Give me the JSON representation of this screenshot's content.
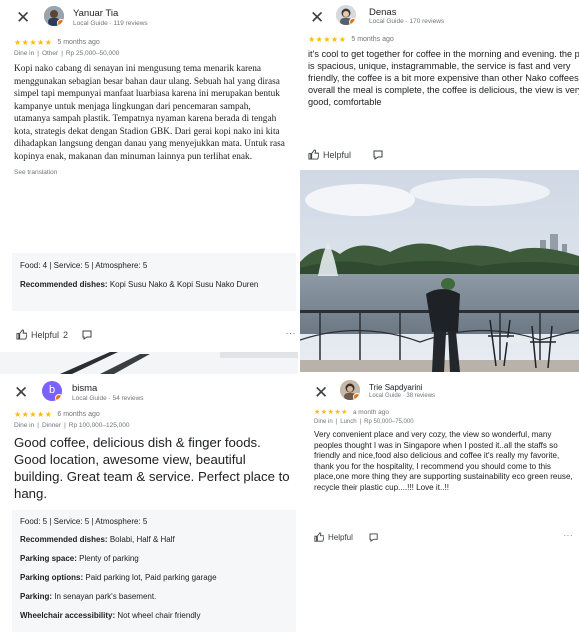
{
  "reviews": [
    {
      "reviewer_name": "Yanuar Tia",
      "reviewer_meta": "Local Guide · 119 reviews",
      "stars": "★★★★★",
      "time": "5 months ago",
      "meal_type": "Dine in",
      "meal_kind": "Other",
      "price": "Rp 25,000–50,000",
      "body": "Kopi nako cabang di senayan ini mengusung tema menarik karena menggunakan sebagian besar bahan daur ulang. Sebuah hal yang dirasa simpel tapi mempunyai manfaat luarbiasa karena ini merupakan bentuk kampanye untuk menjaga lingkungan dari pencemaran sampah, utamanya sampah plastik. Tempatnya nyaman karena berada di tengah kota, strategis dekat dengan Stadion GBK. Dari gerai kopi nako ini kita dihadapkan langsung dengan danau yang menyejukkan mata. Untuk rasa kopinya enak, makanan dan minuman lainnya pun terlihat enak.",
      "see_translation": "See translation",
      "ratings_line": "Food: 4 | Service: 5 | Atmosphere: 5",
      "recommended_label": "Recommended dishes:",
      "recommended_value": "Kopi Susu Nako & Kopi Susu Nako Duren",
      "helpful_label": "Helpful",
      "helpful_count": "2",
      "more": "···"
    },
    {
      "reviewer_name": "Denas",
      "reviewer_meta": "Local Guide · 170 reviews",
      "stars": "★★★★★",
      "time": "5 months ago",
      "body": "it's cool to get together for coffee in the morning and evening.  the place is spacious, unique, instagrammable, the service is fast and very friendly, the coffee is a bit more expensive than other Nako coffees, but overall the meal is complete, the coffee is delicious, the view is very good, comfortable",
      "helpful_label": "Helpful"
    },
    {
      "reviewer_name": "bisma",
      "avatar_letter": "b",
      "reviewer_meta": "Local Guide · 54 reviews",
      "stars": "★★★★★",
      "time": "6 months ago",
      "meal_type": "Dine in",
      "meal_kind": "Dinner",
      "price": "Rp 100,000–125,000",
      "body": "Good coffee, delicious dish & finger foods. Good location, awesome view, beautiful building. Great team & service. Perfect place to hang.",
      "ratings_line": "Food: 5 | Service: 5 | Atmosphere: 5",
      "details": [
        {
          "label": "Recommended dishes:",
          "value": "Bolabi, Half & Half"
        },
        {
          "label": "Parking space:",
          "value": "Plenty of parking"
        },
        {
          "label": "Parking options:",
          "value": "Paid parking lot, Paid parking garage"
        },
        {
          "label": "Parking:",
          "value": "In senayan park's basement."
        },
        {
          "label": "Wheelchair accessibility:",
          "value": "Not wheel chair friendly"
        }
      ]
    },
    {
      "reviewer_name": "Trie Sapdyarini",
      "reviewer_meta": "Local Guide · 38 reviews",
      "stars": "★★★★★",
      "time": "a month ago",
      "meal_type": "Dine in",
      "meal_kind": "Lunch",
      "price": "Rp 50,000–75,000",
      "body": "Very convenient place and very cozy, the view so wonderful, many peoples thought I was in Singapore when I posted it..all the staffs so friendly and nice,food also delicious and coffee it's really my favorite, thank you for the hospitality, I recommend you should come to this place,one more thing they are supporting sustainability eco green reuse, recycle  their plastic cup....!!! Love it..!!",
      "helpful_label": "Helpful",
      "more": "···"
    }
  ],
  "colors": {
    "star": "#fbbc04",
    "badge": "#e8710a",
    "bisma_avatar": "#7b61ff",
    "muted": "#70757a",
    "details_bg": "#f6f7f8"
  },
  "icons": [
    "close-icon",
    "thumbs-up-icon",
    "share-icon",
    "more-icon",
    "local-guide-badge-icon"
  ]
}
